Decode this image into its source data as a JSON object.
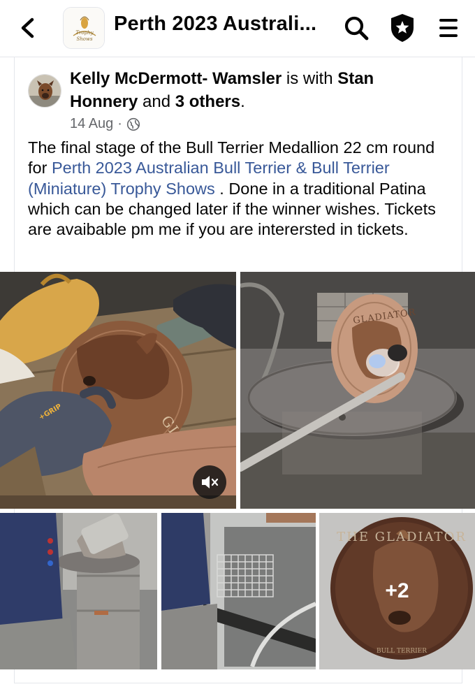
{
  "header": {
    "title": "Perth 2023 Australi...",
    "back_icon": "chevron-left-icon",
    "search_icon": "search-icon",
    "shield_icon": "shield-star-icon",
    "menu_icon": "hamburger-menu-icon",
    "logo_text": "Trophy\nShows"
  },
  "post": {
    "author": "Kelly McDermott- Wamsler",
    "with_text": " is with ",
    "tagged_person": "Stan Honnery",
    "and_text": " and ",
    "others": "3 others",
    "period": ".",
    "date": "14 Aug",
    "separator": "·",
    "privacy_icon": "globe-icon",
    "text_before_link": "The final stage of the Bull Terrier Medallion  22 cm round for ",
    "link_text": "Perth 2023 Australian Bull Terrier & Bull Terrier (Miniature) Trophy Shows",
    "text_after_link": " . Done in a traditional Patina which can be changed later if the winner wishes. Tickets are avaibable pm me if you are interersted in tickets.",
    "more_photos_label": "+2",
    "mute_icon": "speaker-muted-icon"
  },
  "photos": {
    "medallion_text_top": "THE GLADIATOR",
    "medallion_text_bottom": "BULL TERRIER",
    "glove_print": "+GRIP"
  },
  "colors": {
    "link": "#385898",
    "meta": "#65676b",
    "divider": "#e4e6eb",
    "bronze": "#8a5a3c"
  }
}
